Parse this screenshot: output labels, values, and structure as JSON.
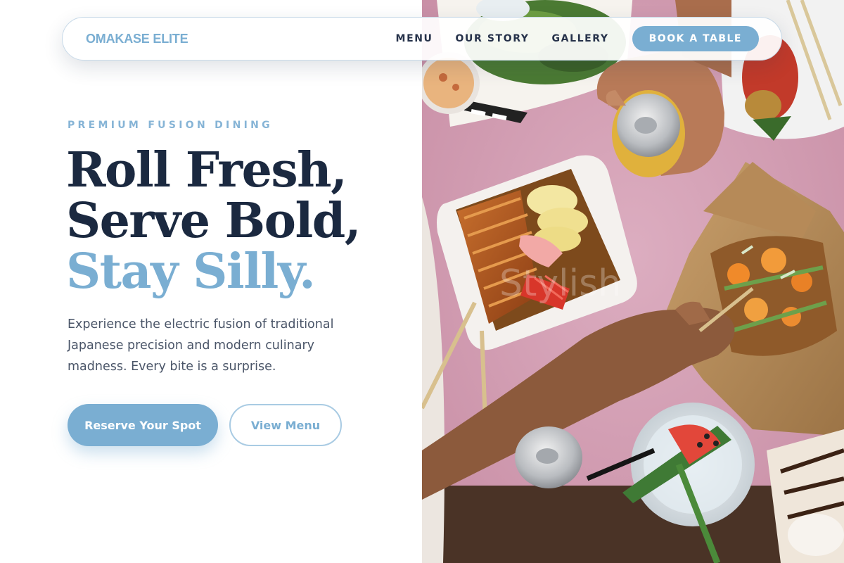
{
  "nav": {
    "brand": "OMAKASE ELITE",
    "links": [
      "MENU",
      "OUR STORY",
      "GALLERY"
    ],
    "cta": "BOOK A TABLE"
  },
  "hero": {
    "eyebrow": "PREMIUM FUSION DINING",
    "headline": [
      "Roll Fresh,",
      "Serve Bold,",
      "Stay Silly."
    ],
    "lead": "Experience the electric fusion of traditional Japanese precision and modern culinary madness. Every bite is a surprise.",
    "primary_button": "Reserve Your Spot",
    "secondary_button": "View Menu"
  },
  "photo": {
    "subject": "overhead-food-photo",
    "watermark": "Stylish"
  },
  "colors": {
    "accent": "#7aaed2",
    "heading": "#1b2940",
    "body": "#4a5568",
    "table_pink": "#d6a3b7"
  }
}
